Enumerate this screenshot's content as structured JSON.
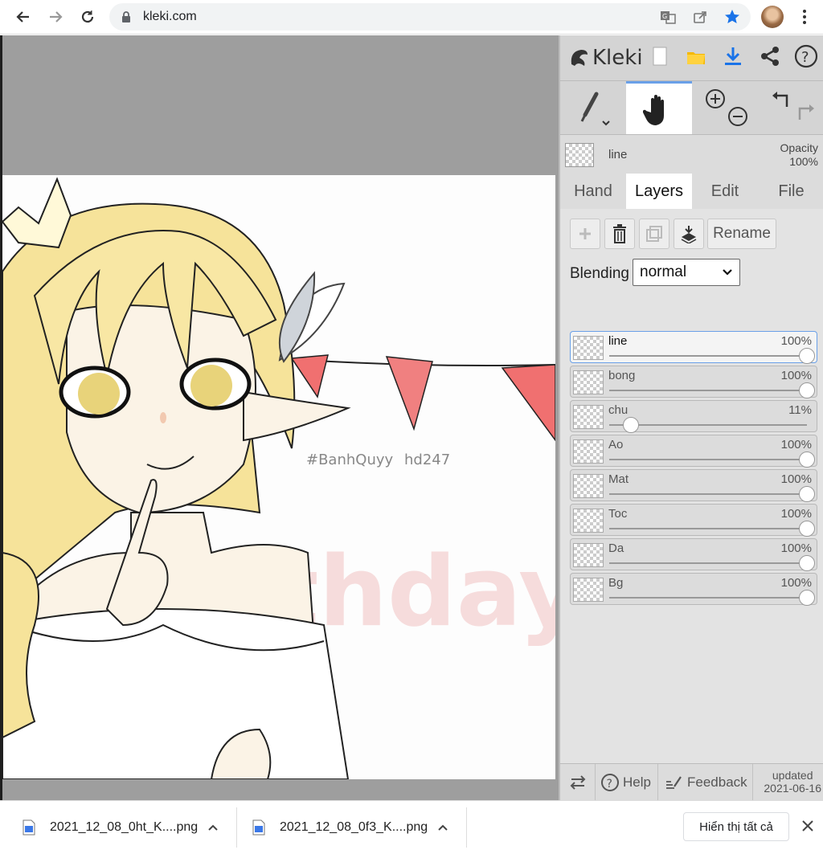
{
  "browser": {
    "url": "kleki.com",
    "icons": [
      "back-icon",
      "forward-icon",
      "reload-icon",
      "lock-icon",
      "translate-icon",
      "share-icon",
      "star-icon",
      "menu-icon"
    ]
  },
  "app": {
    "logo": "Kleki",
    "current_layer": "line",
    "opacity_label": "Opacity",
    "opacity_value": "100%",
    "tabs": [
      "Hand",
      "Layers",
      "Edit",
      "File"
    ],
    "active_tab": "Layers",
    "rename_label": "Rename",
    "blending_label": "Blending",
    "blending_value": "normal",
    "layers": [
      {
        "name": "line",
        "opacity": "100%",
        "level": 1.0,
        "selected": true
      },
      {
        "name": "bong",
        "opacity": "100%",
        "level": 1.0,
        "selected": false
      },
      {
        "name": "chu",
        "opacity": "11%",
        "level": 0.11,
        "selected": false
      },
      {
        "name": "Ao",
        "opacity": "100%",
        "level": 1.0,
        "selected": false
      },
      {
        "name": "Mat",
        "opacity": "100%",
        "level": 1.0,
        "selected": false
      },
      {
        "name": "Toc",
        "opacity": "100%",
        "level": 1.0,
        "selected": false
      },
      {
        "name": "Da",
        "opacity": "100%",
        "level": 1.0,
        "selected": false
      },
      {
        "name": "Bg",
        "opacity": "100%",
        "level": 1.0,
        "selected": false
      }
    ],
    "bottom": {
      "help": "Help",
      "feedback": "Feedback",
      "updated_label": "updated",
      "updated_date": "2021-06-16"
    }
  },
  "artwork": {
    "watermark": "#BanhQuyy",
    "signature": "hd247",
    "bg_text": "birthday"
  },
  "downloads": {
    "files": [
      "2021_12_08_0ht_K....png",
      "2021_12_08_0f3_K....png"
    ],
    "show_all": "Hiển thị tất cả"
  }
}
